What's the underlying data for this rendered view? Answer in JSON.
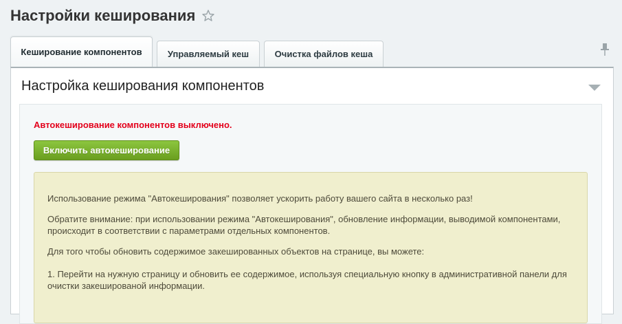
{
  "page": {
    "title": "Настройки кеширования"
  },
  "tabs": [
    {
      "label": "Кеширование компонентов",
      "active": true
    },
    {
      "label": "Управляемый кеш",
      "active": false
    },
    {
      "label": "Очистка файлов кеша",
      "active": false
    }
  ],
  "section": {
    "title": "Настройка кеширования компонентов",
    "status": "Автокеширование компонентов выключено.",
    "enable_button": "Включить автокеширование"
  },
  "notice": {
    "p1": "Использование режима \"Автокеширования\" позволяет ускорить работу вашего сайта в несколько раз!",
    "p2": "Обратите внимание: при использовании режима \"Автокеширования\", обновление информации, выводимой компонентами, происходит в соответствии с параметрами отдельных компонентов.",
    "p3": "Для того чтобы обновить содержимое закешированных объектов на странице, вы можете:",
    "p4": "1. Перейти на нужную страницу и обновить ее содержимое, используя специальную кнопку в административной панели для очистки закешированой информации."
  },
  "colors": {
    "status_red": "#e3001b",
    "button_green": "#7ab22e",
    "notice_bg": "#f0efce"
  },
  "icons": [
    "star-icon",
    "pin-icon",
    "collapse-icon"
  ]
}
